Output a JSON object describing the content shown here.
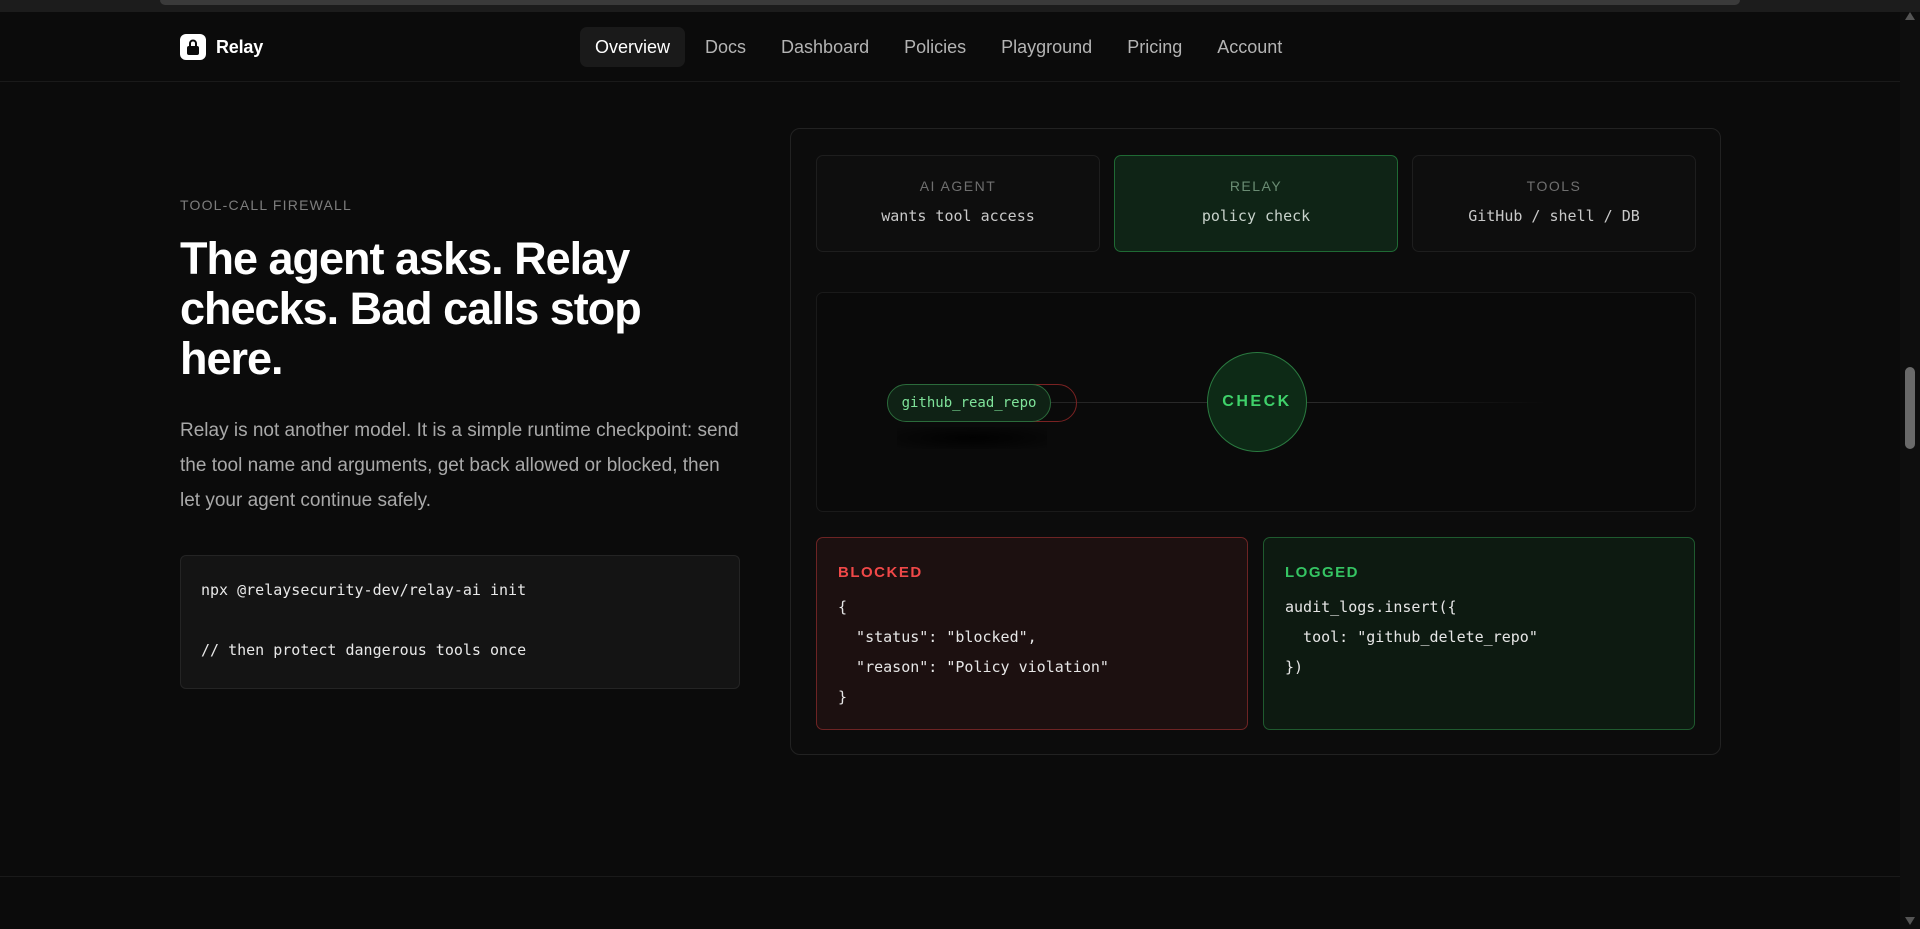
{
  "brand": {
    "name": "Relay",
    "icon": "lock-icon"
  },
  "nav": {
    "items": [
      {
        "label": "Overview",
        "active": true
      },
      {
        "label": "Docs"
      },
      {
        "label": "Dashboard"
      },
      {
        "label": "Policies"
      },
      {
        "label": "Playground"
      },
      {
        "label": "Pricing"
      },
      {
        "label": "Account"
      }
    ]
  },
  "hero": {
    "eyebrow": "TOOL-CALL FIREWALL",
    "headline": "The agent asks. Relay checks. Bad calls stop here.",
    "lede": "Relay is not another model. It is a simple runtime checkpoint: send the tool name and arguments, get back allowed or blocked, then let your agent continue safely.",
    "code": {
      "line1": "npx @relaysecurity-dev/relay-ai init",
      "line2": "// then protect dangerous tools once"
    }
  },
  "demo": {
    "nodes": {
      "agent": {
        "caption": "AI AGENT",
        "desc": "wants tool access"
      },
      "relay": {
        "caption": "RELAY",
        "desc": "policy check"
      },
      "tools": {
        "caption": "TOOLS",
        "desc": "GitHub / shell / DB"
      }
    },
    "flow": {
      "tool_call": "github_read_repo",
      "check_label": "CHECK"
    },
    "blocked": {
      "title": "BLOCKED",
      "code": "{\n  \"status\": \"blocked\",\n  \"reason\": \"Policy violation\"\n}"
    },
    "logged": {
      "title": "LOGGED",
      "code": "audit_logs.insert({\n  tool: \"github_delete_repo\"\n})"
    }
  },
  "colors": {
    "background": "#0b0b0b",
    "accent_green": "#3fd16a",
    "blocked_red": "#f04848"
  }
}
